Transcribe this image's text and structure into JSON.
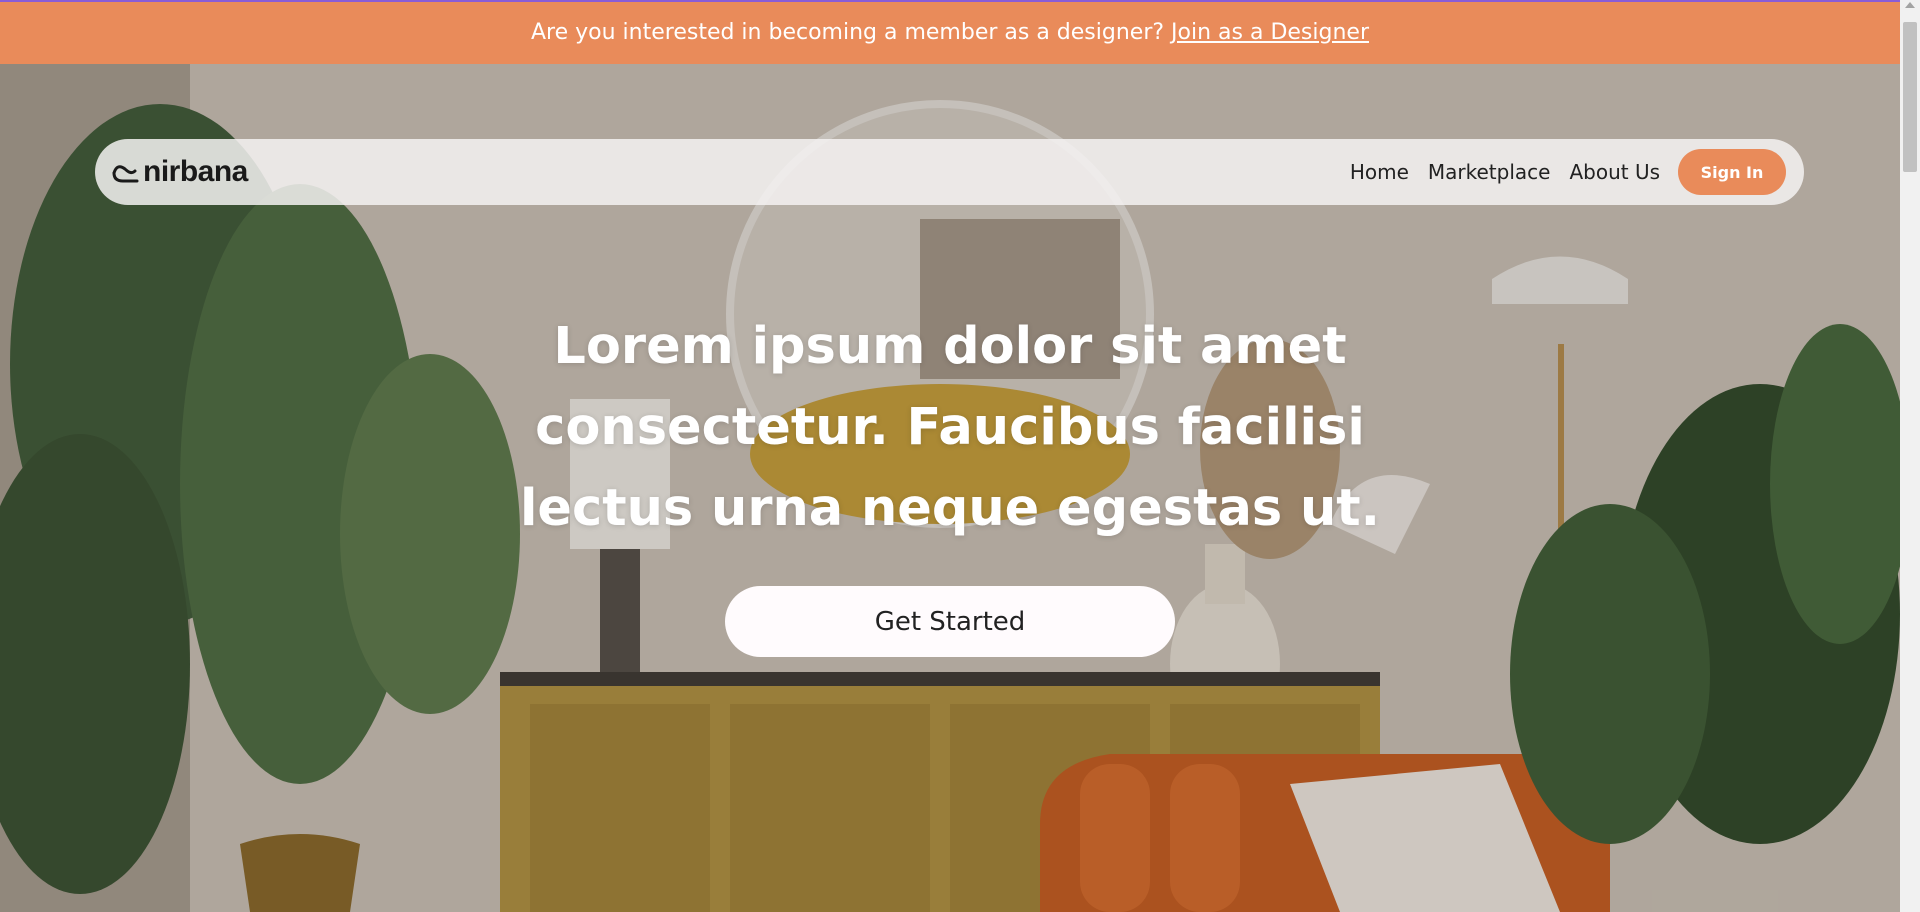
{
  "announcement": {
    "text": "Are you interested in becoming a member as a designer?",
    "link": "Join as a Designer"
  },
  "navbar": {
    "logo_text": "nirbana",
    "links": [
      "Home",
      "Marketplace",
      "About Us"
    ],
    "signin_label": "Sign In"
  },
  "hero": {
    "headline": "Lorem ipsum dolor sit amet consectetur. Faucibus facilisi lectus urna neque egestas ut.",
    "cta_label": "Get Started"
  },
  "colors": {
    "accent": "#e98b5a",
    "topline": "#8a5cd6",
    "cta_bg": "#fffbfd"
  },
  "icons": {
    "logo": "nirbana-logo-icon",
    "scroll": "scroll-up-arrow-icon"
  }
}
